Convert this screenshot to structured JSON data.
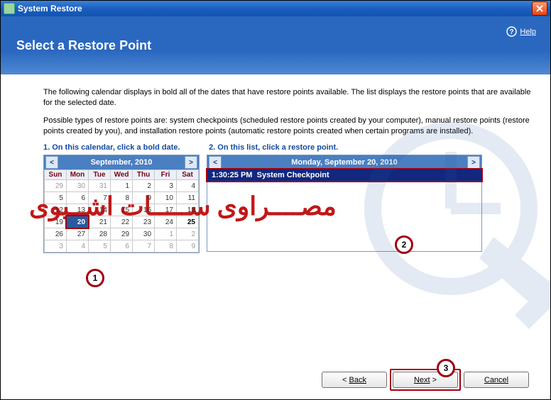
{
  "window": {
    "title": "System Restore"
  },
  "header": {
    "title": "Select a Restore Point",
    "help": "Help"
  },
  "intro": {
    "p1": "The following calendar displays in bold all of the dates that have restore points available. The list displays the restore points that are available for the selected date.",
    "p2": "Possible types of restore points are: system checkpoints (scheduled restore points created by your computer), manual restore points (restore points created by you), and installation restore points (automatic restore points created when certain programs are installed)."
  },
  "steps": {
    "s1": "1. On this calendar, click a bold date.",
    "s2": "2. On this list, click a restore point."
  },
  "calendar": {
    "title": "September, 2010",
    "dow": [
      "Sun",
      "Mon",
      "Tue",
      "Wed",
      "Thu",
      "Fri",
      "Sat"
    ],
    "grid": [
      [
        {
          "d": "29",
          "o": true
        },
        {
          "d": "30",
          "o": true
        },
        {
          "d": "31",
          "o": true
        },
        {
          "d": "1"
        },
        {
          "d": "2"
        },
        {
          "d": "3"
        },
        {
          "d": "4"
        }
      ],
      [
        {
          "d": "5"
        },
        {
          "d": "6"
        },
        {
          "d": "7"
        },
        {
          "d": "8"
        },
        {
          "d": "9"
        },
        {
          "d": "10"
        },
        {
          "d": "11"
        }
      ],
      [
        {
          "d": "12"
        },
        {
          "d": "13"
        },
        {
          "d": "14"
        },
        {
          "d": "15"
        },
        {
          "d": "16"
        },
        {
          "d": "17"
        },
        {
          "d": "18"
        }
      ],
      [
        {
          "d": "19"
        },
        {
          "d": "20",
          "b": true,
          "sel": true
        },
        {
          "d": "21"
        },
        {
          "d": "22"
        },
        {
          "d": "23"
        },
        {
          "d": "24"
        },
        {
          "d": "25",
          "b": true
        }
      ],
      [
        {
          "d": "26"
        },
        {
          "d": "27"
        },
        {
          "d": "28"
        },
        {
          "d": "29"
        },
        {
          "d": "30"
        },
        {
          "d": "1",
          "o": true
        },
        {
          "d": "2",
          "o": true
        }
      ],
      [
        {
          "d": "3",
          "o": true
        },
        {
          "d": "4",
          "o": true
        },
        {
          "d": "5",
          "o": true
        },
        {
          "d": "6",
          "o": true
        },
        {
          "d": "7",
          "o": true
        },
        {
          "d": "8",
          "o": true
        },
        {
          "d": "9",
          "o": true
        }
      ]
    ]
  },
  "list": {
    "title": "Monday, September 20, 2010",
    "items": [
      {
        "time": "1:30:25 PM",
        "name": "System Checkpoint"
      }
    ]
  },
  "footer": {
    "back": "Back",
    "next": "Next",
    "cancel": "Cancel"
  },
  "markers": {
    "m1": "1",
    "m2": "2",
    "m3": "3"
  },
  "overlay": "مصــــراوى ســـــات اشــيوى"
}
